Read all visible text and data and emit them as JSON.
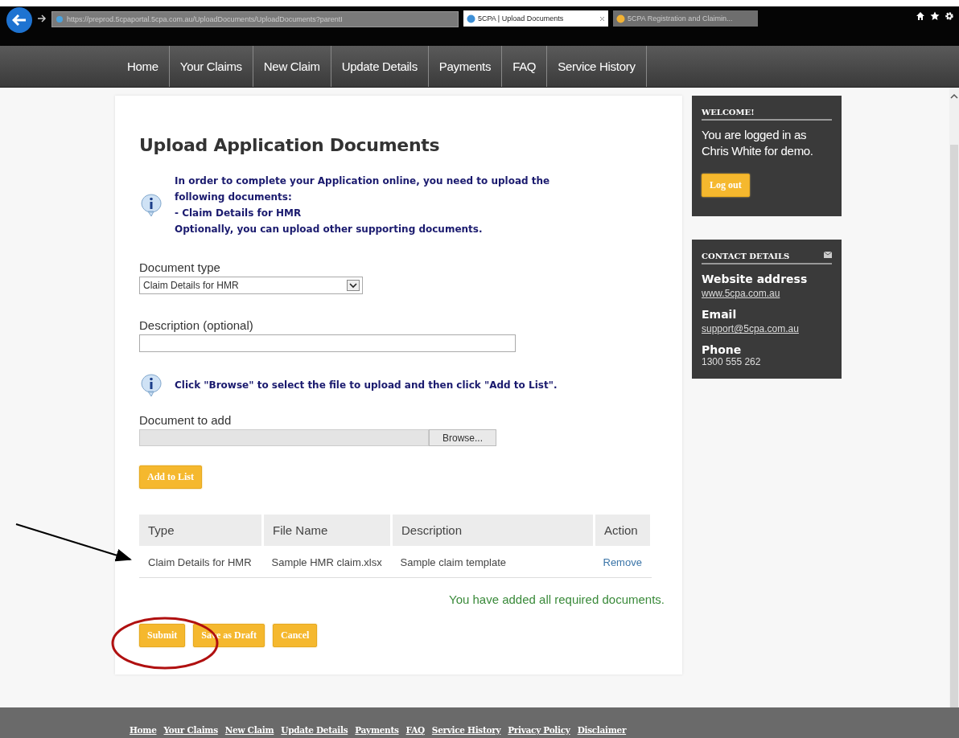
{
  "browser": {
    "url": "https://preprod.5cpaportal.5cpa.com.au/UploadDocuments/UploadDocuments?parentI",
    "tabs": [
      {
        "label": "5CPA | Upload Documents",
        "selected": true
      },
      {
        "label": "5CPA Registration and Claimin...",
        "selected": false
      }
    ]
  },
  "nav": {
    "items": [
      "Home",
      "Your Claims",
      "New Claim",
      "Update Details",
      "Payments",
      "FAQ",
      "Service History"
    ]
  },
  "page": {
    "title": "Upload Application Documents",
    "info": [
      "In order to complete your Application online, you need to upload the following documents:",
      "- Claim Details for HMR",
      "Optionally, you can upload other supporting documents."
    ],
    "document_type": {
      "label": "Document type",
      "value": "Claim Details for HMR"
    },
    "description": {
      "label": "Description (optional)"
    },
    "browse_hint": "Click \"Browse\" to select the file to upload and then click \"Add to List\".",
    "document_to_add": {
      "label": "Document to add",
      "button": "Browse..."
    },
    "add_button": "Add to List",
    "table": {
      "columns": [
        "Type",
        "File Name",
        "Description",
        "Action"
      ],
      "rows": [
        {
          "type": "Claim Details for HMR",
          "file_name": "Sample HMR claim.xlsx",
          "description": "Sample claim template",
          "action": "Remove"
        }
      ]
    },
    "status": "You have added all required documents.",
    "buttons": [
      "Submit",
      "Save as Draft",
      "Cancel"
    ]
  },
  "sidebar": {
    "welcome": {
      "heading": "WELCOME!",
      "text": "You are logged in as Chris White for demo.",
      "button": "Log out"
    },
    "contact": {
      "heading": "CONTACT DETAILS",
      "fields": [
        {
          "label": "Website address",
          "value": "www.5cpa.com.au",
          "kind": "link"
        },
        {
          "label": "Email",
          "value": "support@5cpa.com.au",
          "kind": "link"
        },
        {
          "label": "Phone",
          "value": "1300 555 262",
          "kind": "text"
        }
      ]
    }
  },
  "footer": {
    "links": [
      "Home",
      "Your Claims",
      "New Claim",
      "Update Details",
      "Payments",
      "FAQ",
      "Service History",
      "Privacy Policy",
      "Disclaimer"
    ]
  }
}
